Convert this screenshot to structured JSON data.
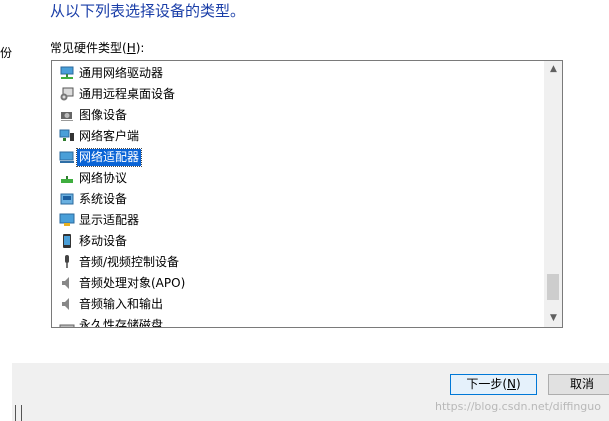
{
  "instruction": "从以下列表选择设备的类型。",
  "left_fragment": "份",
  "list": {
    "label_text": "常见硬件类型(",
    "label_accel": "H",
    "label_tail": "):",
    "items": [
      {
        "label": "通用网络驱动器",
        "icon": "network-drive-icon"
      },
      {
        "label": "通用远程桌面设备",
        "icon": "remote-desktop-icon"
      },
      {
        "label": "图像设备",
        "icon": "camera-icon"
      },
      {
        "label": "网络客户端",
        "icon": "network-client-icon"
      },
      {
        "label": "网络适配器",
        "icon": "network-adapter-icon",
        "selected": true
      },
      {
        "label": "网络协议",
        "icon": "network-protocol-icon"
      },
      {
        "label": "系统设备",
        "icon": "system-device-icon"
      },
      {
        "label": "显示适配器",
        "icon": "display-adapter-icon"
      },
      {
        "label": "移动设备",
        "icon": "mobile-device-icon"
      },
      {
        "label": "音频/视频控制设备",
        "icon": "audio-video-controller-icon"
      },
      {
        "label": "音频处理对象(APO)",
        "icon": "speaker-icon"
      },
      {
        "label": "音频输入和输出",
        "icon": "speaker-icon"
      },
      {
        "label": "永久性存储磁盘",
        "icon": "storage-disk-icon"
      }
    ]
  },
  "buttons": {
    "next_text": "下一步(",
    "next_accel": "N",
    "next_tail": ")",
    "cancel": "取消"
  },
  "watermark": "https://blog.csdn.net/diffinguo",
  "colors": {
    "instruction": "#1a3ea8",
    "selection": "#0a64d6",
    "footer": "#f0f0f0"
  }
}
